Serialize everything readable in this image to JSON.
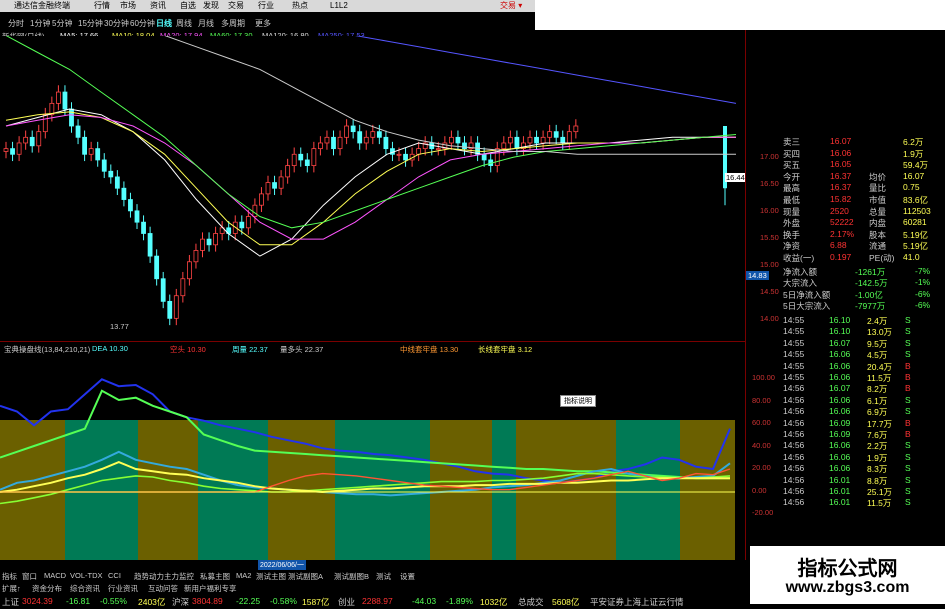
{
  "window": {
    "items": [
      "通达信金融终端",
      "行情",
      "市场",
      "资讯",
      "自选",
      "发现",
      "交易",
      "行业",
      "热点",
      "L1L2"
    ],
    "right_label": "交易 ▾"
  },
  "toolbar": {
    "periods": [
      "分时",
      "1分钟",
      "5分钟",
      "15分钟",
      "30分钟",
      "60分钟",
      "日线",
      "周线",
      "月线",
      "多周期",
      "更多"
    ],
    "active": "日线"
  },
  "main_chart": {
    "symbol_label": "新华网(日线)",
    "ma_items": [
      {
        "label": "MA5: 17.66",
        "color": "#ffffff"
      },
      {
        "label": "MA10: 18.04",
        "color": "#ffff55"
      },
      {
        "label": "MA20: 17.94",
        "color": "#ff55ff"
      },
      {
        "label": "MA60: 17.30",
        "color": "#55ff55"
      },
      {
        "label": "MA120: 16.80",
        "color": "#dddddd"
      },
      {
        "label": "MA250: 17.53",
        "color": "#5555ff"
      }
    ],
    "low_marker": "13.77",
    "price_tag": "14.83",
    "last_price_tag": "16.44",
    "y_ticks": [
      "17.00",
      "16.50",
      "16.00",
      "15.50",
      "15.00",
      "14.50",
      "14.00"
    ]
  },
  "indicator_chart": {
    "name": "宝典操盘线(13,84,210,21)",
    "items": [
      {
        "label": "DEA 10.30",
        "color": "#5ff"
      },
      {
        "label": "空头 10.30",
        "color": "#f33"
      },
      {
        "label": "周量 22.37",
        "color": "#5ff"
      },
      {
        "label": "量多头 22.37",
        "color": "#ccc"
      },
      {
        "label": "中线套牢盘 13.30",
        "color": "#f93"
      },
      {
        "label": "长线套牢盘 3.12",
        "color": "#ff5"
      }
    ],
    "popup": "指标说明",
    "y_ticks": [
      "100.00",
      "80.00",
      "60.00",
      "40.00",
      "20.00",
      "0.00",
      "-20.00"
    ],
    "date_label": "2022/06/06/一"
  },
  "quote_panel": {
    "rows": [
      {
        "a": "卖三",
        "b": "16.07",
        "c": "",
        "d": "6.2万"
      },
      {
        "a": "买四",
        "b": "16.06",
        "c": "",
        "d": "1.9万"
      },
      {
        "a": "买五",
        "b": "16.05",
        "c": "",
        "d": "59.4万"
      },
      {
        "a": "今开",
        "b": "16.37",
        "c": "均价",
        "d": "16.07"
      },
      {
        "a": "最高",
        "b": "16.37",
        "c": "量比",
        "d": "0.75"
      },
      {
        "a": "最低",
        "b": "15.82",
        "c": "市值",
        "d": "83.6亿"
      },
      {
        "a": "现量",
        "b": "2520",
        "c": "总量",
        "d": "112503"
      },
      {
        "a": "外盘",
        "b": "52222",
        "c": "内盘",
        "d": "60281"
      },
      {
        "a": "换手",
        "b": "2.17%",
        "c": "股本",
        "d": "5.19亿"
      },
      {
        "a": "净资",
        "b": "6.88",
        "c": "流通",
        "d": "5.19亿"
      },
      {
        "a": "收益(一)",
        "b": "0.197",
        "c": "PE(动)",
        "d": "41.0"
      }
    ],
    "flows": [
      {
        "a": "净流入额",
        "b": "-1261万",
        "c": "-7%"
      },
      {
        "a": "大宗流入",
        "b": "-142.5万",
        "c": "-1%"
      },
      {
        "a": "5日净流入额",
        "b": "-1.00亿",
        "c": "-6%"
      },
      {
        "a": "5日大宗流入",
        "b": "-7977万",
        "c": "-6%"
      }
    ],
    "ticks": [
      {
        "t": "14:55",
        "p": "16.10",
        "v": "2.4万",
        "s": "S"
      },
      {
        "t": "14:55",
        "p": "16.10",
        "v": "13.0万",
        "s": "S"
      },
      {
        "t": "14:55",
        "p": "16.07",
        "v": "9.5万",
        "s": "S"
      },
      {
        "t": "14:55",
        "p": "16.06",
        "v": "4.5万",
        "s": "S"
      },
      {
        "t": "14:55",
        "p": "16.06",
        "v": "20.4万",
        "s": "B"
      },
      {
        "t": "14:55",
        "p": "16.06",
        "v": "11.5万",
        "s": "B"
      },
      {
        "t": "14:56",
        "p": "16.07",
        "v": "8.2万",
        "s": "B"
      },
      {
        "t": "14:56",
        "p": "16.06",
        "v": "6.1万",
        "s": "S"
      },
      {
        "t": "14:56",
        "p": "16.06",
        "v": "6.9万",
        "s": "S"
      },
      {
        "t": "14:56",
        "p": "16.09",
        "v": "17.7万",
        "s": "B"
      },
      {
        "t": "14:56",
        "p": "16.09",
        "v": "7.6万",
        "s": "B"
      },
      {
        "t": "14:56",
        "p": "16.06",
        "v": "2.2万",
        "s": "S"
      },
      {
        "t": "14:56",
        "p": "16.06",
        "v": "1.9万",
        "s": "S"
      },
      {
        "t": "14:56",
        "p": "16.06",
        "v": "8.3万",
        "s": "S"
      },
      {
        "t": "14:56",
        "p": "16.01",
        "v": "8.8万",
        "s": "S"
      },
      {
        "t": "14:56",
        "p": "16.01",
        "v": "25.1万",
        "s": "S"
      },
      {
        "t": "14:56",
        "p": "16.01",
        "v": "11.5万",
        "s": "S"
      }
    ]
  },
  "bottom_tabs": [
    "指标",
    "窗口",
    "MACD",
    "VOL-TDX",
    "CCI",
    "趋势动力",
    "主力监控",
    "私募主图",
    "MA2",
    "测试主图",
    "测试副图A",
    "测试副图B",
    "测试",
    "设置"
  ],
  "bottom_tabs2": [
    "扩展↑",
    "资金分布",
    "综合资讯",
    "行业资讯",
    "互动问答",
    "新用户福利专享"
  ],
  "status": [
    {
      "label": "上证",
      "color": "#ccc"
    },
    {
      "label": "3024.39",
      "color": "#f33"
    },
    {
      "label": "-16.81",
      "color": "#5f5"
    },
    {
      "label": "-0.55%",
      "color": "#5f5"
    },
    {
      "label": "2403亿",
      "color": "#ff5"
    },
    {
      "label": "沪深",
      "color": "#ccc"
    },
    {
      "label": "3804.89",
      "color": "#f33"
    },
    {
      "label": "-22.25",
      "color": "#5f5"
    },
    {
      "label": "-0.58%",
      "color": "#5f5"
    },
    {
      "label": "1587亿",
      "color": "#ff5"
    },
    {
      "label": "创业",
      "color": "#ccc"
    },
    {
      "label": "2288.97",
      "color": "#f33"
    },
    {
      "label": "-44.03",
      "color": "#5f5"
    },
    {
      "label": "-1.89%",
      "color": "#5f5"
    },
    {
      "label": "1032亿",
      "color": "#ff5"
    },
    {
      "label": "总成交",
      "color": "#ccc"
    },
    {
      "label": "5608亿",
      "color": "#ff5"
    },
    {
      "label": "平安证券上海上证云行情",
      "color": "#ccc"
    }
  ],
  "watermark": {
    "title": "指标公式网",
    "url": "www.zbgs3.com"
  }
}
